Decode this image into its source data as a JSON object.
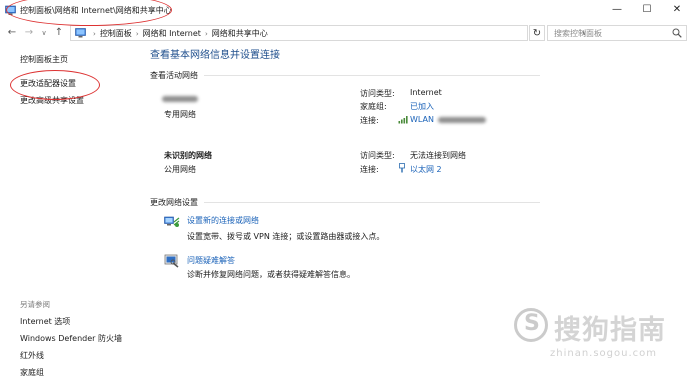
{
  "window": {
    "title": "控制面板\\网络和 Internet\\网络和共享中心",
    "minimize_glyph": "—",
    "maximize_glyph": "☐",
    "close_glyph": "✕"
  },
  "addressbar": {
    "back_glyph": "←",
    "forward_glyph": "→",
    "dropdown_glyph": "∨",
    "up_glyph": "↑",
    "breadcrumbs": [
      "控制面板",
      "网络和 Internet",
      "网络和共享中心"
    ],
    "separator": "›",
    "refresh_glyph": "↻",
    "search_placeholder": "搜索控制面板"
  },
  "sidebar": {
    "links": [
      "控制面板主页",
      "更改适配器设置",
      "更改高级共享设置"
    ],
    "see_also_heading": "另请参阅",
    "see_also_links": [
      "Internet 选项",
      "Windows Defender 防火墙",
      "红外线",
      "家庭组"
    ]
  },
  "main": {
    "title": "查看基本网络信息并设置连接",
    "active_networks_label": "查看活动网络",
    "networks": [
      {
        "name": "",
        "type": "专用网络",
        "access_label": "访问类型:",
        "access_value": "Internet",
        "group_label": "家庭组:",
        "group_value": "已加入",
        "conn_label": "连接:",
        "conn_value": "WLAN"
      },
      {
        "name": "未识别的网络",
        "type": "公用网络",
        "access_label": "访问类型:",
        "access_value": "无法连接到网络",
        "conn_label": "连接:",
        "conn_value": "以太网 2"
      }
    ],
    "change_settings_label": "更改网络设置",
    "tasks": [
      {
        "title": "设置新的连接或网络",
        "desc": "设置宽带、拨号或 VPN 连接；或设置路由器或接入点。",
        "icon": "network-setup-icon"
      },
      {
        "title": "问题疑难解答",
        "desc": "诊断并修复网络问题，或者获得疑难解答信息。",
        "icon": "troubleshoot-icon"
      }
    ]
  },
  "watermark": {
    "logo_letter": "S",
    "text": "搜狗指南",
    "url": "zhinan.sogou.com"
  },
  "colors": {
    "link": "#1a62b8",
    "title": "#1e4e8c",
    "annotation": "#dd3333"
  }
}
